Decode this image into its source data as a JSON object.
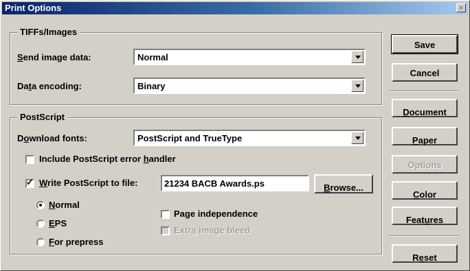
{
  "window": {
    "title": "Print Options",
    "close_glyph": "×"
  },
  "tiffs": {
    "legend": "TIFFs/Images",
    "send_label_u": "S",
    "send_label_rest": "end image data:",
    "send_value": "Normal",
    "enc_label_pre": "Da",
    "enc_label_u": "t",
    "enc_label_rest": "a encoding:",
    "enc_value": "Binary"
  },
  "postscript": {
    "legend": "PostScript",
    "fonts_label_pre": "D",
    "fonts_label_u": "o",
    "fonts_label_rest": "wnload fonts:",
    "fonts_value": "PostScript and TrueType",
    "include_label_pre": "Include PostScript error ",
    "include_label_u": "h",
    "include_label_rest": "andler",
    "include_checked": false,
    "write_label_u": "W",
    "write_label_rest": "rite PostScript to file:",
    "write_checked": true,
    "file_value": "21234 BACB Awards.ps",
    "browse_label_u": "B",
    "browse_label_rest": "rowse...",
    "radio_normal_u": "N",
    "radio_normal_rest": "ormal",
    "radio_eps_u": "E",
    "radio_eps_rest": "PS",
    "radio_prepress_u": "F",
    "radio_prepress_rest": "or prepress",
    "page_indep_pre": "Pa",
    "page_indep_u": "g",
    "page_indep_rest": "e independence",
    "extra_pre": "Extr",
    "extra_u": "a",
    "extra_rest": " image bleed"
  },
  "buttons": {
    "save": "Save",
    "cancel": "Cancel",
    "document_u": "D",
    "document_rest": "ocument",
    "paper_u": "P",
    "paper_rest": "aper",
    "options": "Options",
    "color_u": "C",
    "color_rest": "olor",
    "features_pre": "Feat",
    "features_u": "u",
    "features_rest": "res",
    "reset_pre": "R",
    "reset_u": "e",
    "reset_rest": "set"
  },
  "check_glyph": "✓"
}
